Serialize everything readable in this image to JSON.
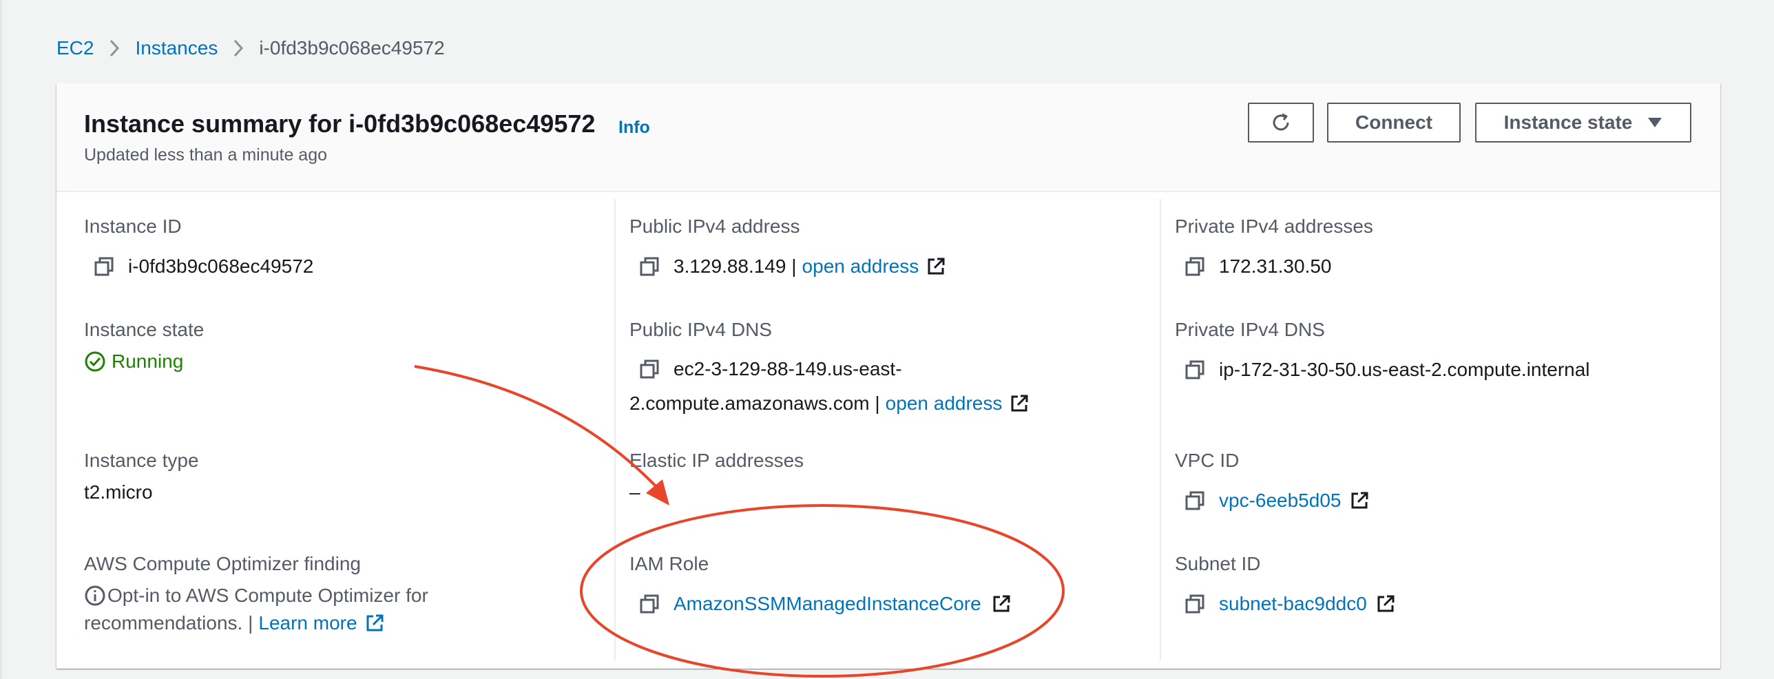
{
  "breadcrumb": {
    "items": [
      "EC2",
      "Instances"
    ],
    "current": "i-0fd3b9c068ec49572"
  },
  "header": {
    "title": "Instance summary for i-0fd3b9c068ec49572",
    "info": "Info",
    "updated": "Updated less than a minute ago",
    "connect_label": "Connect",
    "state_label": "Instance state"
  },
  "fields": {
    "instance_id": {
      "label": "Instance ID",
      "value": "i-0fd3b9c068ec49572"
    },
    "instance_state": {
      "label": "Instance state",
      "value": "Running"
    },
    "instance_type": {
      "label": "Instance type",
      "value": "t2.micro"
    },
    "optimizer": {
      "label": "AWS Compute Optimizer finding",
      "line1": "Opt-in to AWS Compute Optimizer for",
      "line2": "recommendations. |",
      "learn_more": "Learn more"
    },
    "public_ipv4": {
      "label": "Public IPv4 address",
      "value": "3.129.88.149 |",
      "link": "open address"
    },
    "public_dns": {
      "label": "Public IPv4 DNS",
      "line1": "ec2-3-129-88-149.us-east-",
      "line2": "2.compute.amazonaws.com |",
      "link": "open address"
    },
    "elastic_ip": {
      "label": "Elastic IP addresses",
      "value": "–"
    },
    "iam_role": {
      "label": "IAM Role",
      "value": "AmazonSSMManagedInstanceCore"
    },
    "private_ipv4": {
      "label": "Private IPv4 addresses",
      "value": "172.31.30.50"
    },
    "private_dns": {
      "label": "Private IPv4 DNS",
      "value": "ip-172-31-30-50.us-east-2.compute.internal"
    },
    "vpc_id": {
      "label": "VPC ID",
      "value": "vpc-6eeb5d05"
    },
    "subnet_id": {
      "label": "Subnet ID",
      "value": "subnet-bac9ddc0"
    }
  },
  "colors": {
    "link": "#0073bb",
    "running": "#1d8102",
    "annotation": "#e8462a",
    "label": "#545b64"
  },
  "icons": [
    "chevron-right-icon",
    "refresh-icon",
    "caret-down-icon",
    "copy-icon",
    "external-link-icon",
    "status-check-icon",
    "info-circle-icon"
  ]
}
